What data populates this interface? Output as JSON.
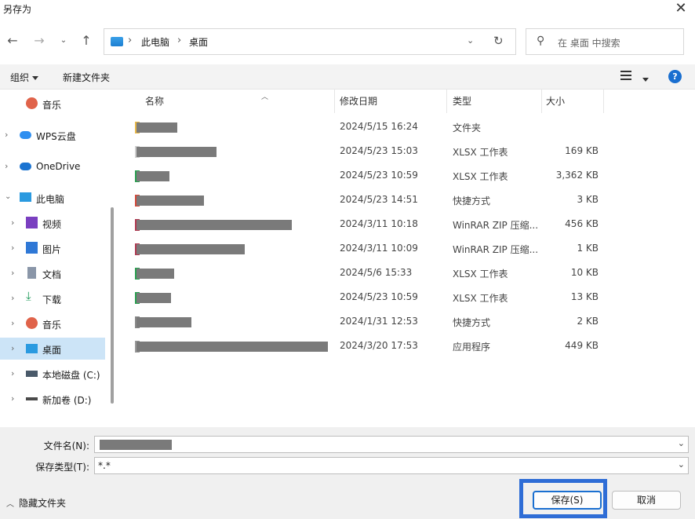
{
  "window": {
    "title": "另存为"
  },
  "nav": {
    "breadcrumb": [
      "此电脑",
      "桌面"
    ],
    "search_placeholder": "在 桌面 中搜索"
  },
  "toolbar": {
    "organize": "组织",
    "new_folder": "新建文件夹"
  },
  "sidebar": {
    "items": [
      {
        "label": "音乐",
        "icon": "music-icon",
        "color": "#e0634a"
      },
      {
        "label": "WPS云盘",
        "icon": "cloud-icon",
        "color": "#2f8ff0"
      },
      {
        "label": "OneDrive",
        "icon": "onedrive-icon",
        "color": "#1a73d1"
      },
      {
        "label": "此电脑",
        "icon": "computer-icon",
        "color": "#2a9ae0"
      },
      {
        "label": "视频",
        "icon": "video-icon",
        "color": "#7a3fc0"
      },
      {
        "label": "图片",
        "icon": "picture-icon",
        "color": "#2f78d6"
      },
      {
        "label": "文档",
        "icon": "document-icon",
        "color": "#8a96a8"
      },
      {
        "label": "下载",
        "icon": "download-icon",
        "color": "#1f9a5a"
      },
      {
        "label": "音乐",
        "icon": "music-icon",
        "color": "#e0634a"
      },
      {
        "label": "桌面",
        "icon": "desktop-icon",
        "color": "#2a9ae0"
      },
      {
        "label": "本地磁盘 (C:)",
        "icon": "drive-icon",
        "color": "#4a5a6a"
      },
      {
        "label": "新加卷 (D:)",
        "icon": "drive-icon",
        "color": "#4a4a4a"
      }
    ]
  },
  "columns": {
    "name": "名称",
    "modified": "修改日期",
    "type": "类型",
    "size": "大小"
  },
  "files": [
    {
      "modified": "2024/5/15 16:24",
      "type": "文件夹",
      "size": "",
      "mark": "#e8b84a"
    },
    {
      "modified": "2024/5/23 15:03",
      "type": "XLSX 工作表",
      "size": "169 KB",
      "mark": "#cfcfcf"
    },
    {
      "modified": "2024/5/23 10:59",
      "type": "XLSX 工作表",
      "size": "3,362 KB",
      "mark": "#2aa051"
    },
    {
      "modified": "2024/5/23 14:51",
      "type": "快捷方式",
      "size": "3 KB",
      "mark": "#d44a3a"
    },
    {
      "modified": "2024/3/11 10:18",
      "type": "WinRAR ZIP 压缩...",
      "size": "456 KB",
      "mark": "#b03a52"
    },
    {
      "modified": "2024/3/11 10:09",
      "type": "WinRAR ZIP 压缩...",
      "size": "1 KB",
      "mark": "#b03a52"
    },
    {
      "modified": "2024/5/6 15:33",
      "type": "XLSX 工作表",
      "size": "10 KB",
      "mark": "#2aa051"
    },
    {
      "modified": "2024/5/23 10:59",
      "type": "XLSX 工作表",
      "size": "13 KB",
      "mark": "#2aa051"
    },
    {
      "modified": "2024/1/31 12:53",
      "type": "快捷方式",
      "size": "2 KB",
      "mark": "#8a8a8a"
    },
    {
      "modified": "2024/3/20 17:53",
      "type": "应用程序",
      "size": "449 KB",
      "mark": "#9a9a9a"
    }
  ],
  "form": {
    "filename_label": "文件名(N):",
    "filetype_label": "保存类型(T):",
    "filetype_value": "*.*"
  },
  "footer": {
    "hide_folders": "隐藏文件夹",
    "save": "保存(S)",
    "cancel": "取消",
    "highlight_color": "#2f6dd6"
  }
}
